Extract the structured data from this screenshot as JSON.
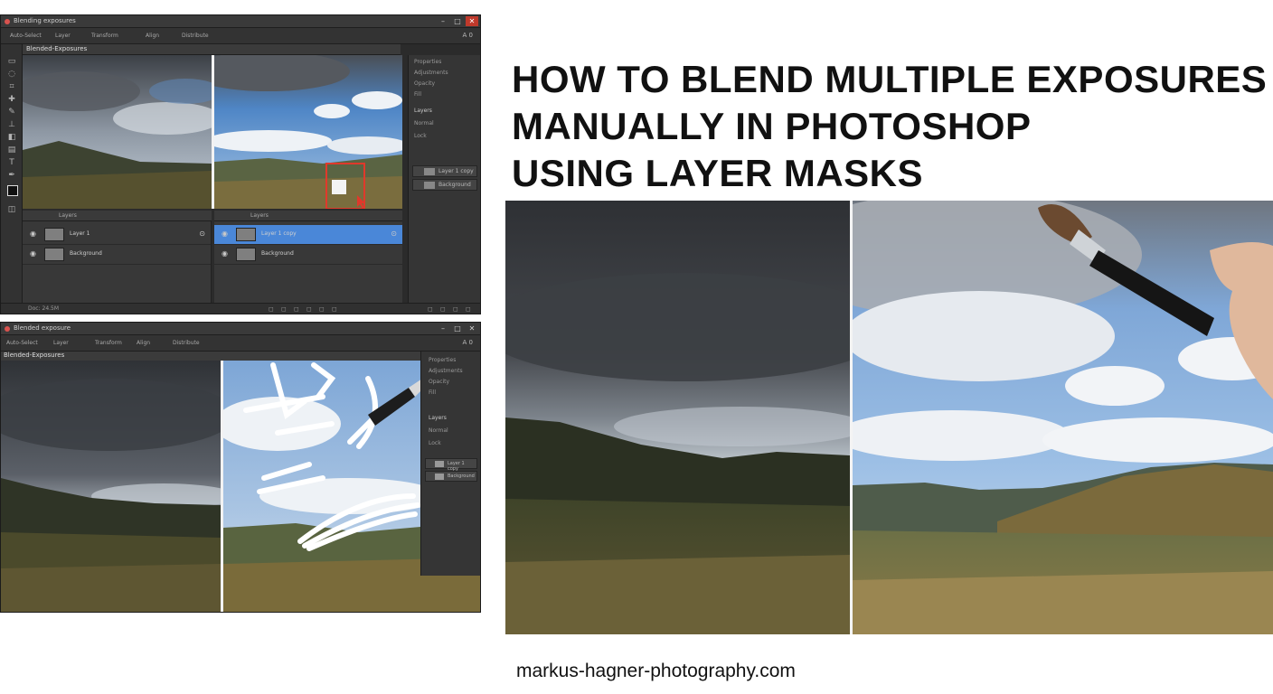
{
  "headline": {
    "line1": "HOW TO BLEND MULTIPLE EXPOSURES",
    "line2": "MANUALLY IN PHOTOSHOP",
    "line3": "USING LAYER MASKS"
  },
  "footer": {
    "website": "markus-hagner-photography.com"
  },
  "screenshot_top": {
    "window_title": "Blending exposures",
    "window_controls": {
      "minimize": "–",
      "maximize": "□",
      "close": "✕"
    },
    "options_bar": [
      "Auto-Select",
      "Layer",
      "Transform",
      "Align",
      "Distribute"
    ],
    "zoom_label": "A 0",
    "document_tab": "Blended-Exposures",
    "layers_panel_left": {
      "header": "Layers",
      "rows": [
        {
          "name": "Layer 1",
          "selected": false
        },
        {
          "name": "Background",
          "selected": false
        }
      ]
    },
    "layers_panel_right": {
      "header": "Layers",
      "rows": [
        {
          "name": "Layer 1 copy",
          "selected": true
        },
        {
          "name": "Background",
          "selected": false
        }
      ]
    },
    "side_panel": {
      "rows": [
        "Properties",
        "Adjustments",
        "Opacity",
        "Fill",
        "Layers",
        "Normal",
        "Lock"
      ],
      "layers": [
        "Layer 1 copy",
        "Background"
      ]
    },
    "status_text": "Doc: 24.5M",
    "accent_color": "#4a87d8",
    "highlight_color": "#e0392b"
  },
  "screenshot_bottom": {
    "window_title": "Blended exposure",
    "options_bar": [
      "Auto-Select",
      "Layer",
      "Transform",
      "Align",
      "Distribute"
    ],
    "zoom_label": "A 0",
    "document_tab": "Blended-Exposures",
    "side_panel": {
      "rows": [
        "Properties",
        "Adjustments",
        "Opacity",
        "Fill",
        "Layers",
        "Normal",
        "Lock"
      ],
      "layers": [
        "Layer 1 copy",
        "Background"
      ]
    }
  },
  "icons": {
    "eye": "eye-icon",
    "lock": "lock-icon",
    "brush": "paintbrush-icon",
    "cursor": "cursor-icon"
  }
}
